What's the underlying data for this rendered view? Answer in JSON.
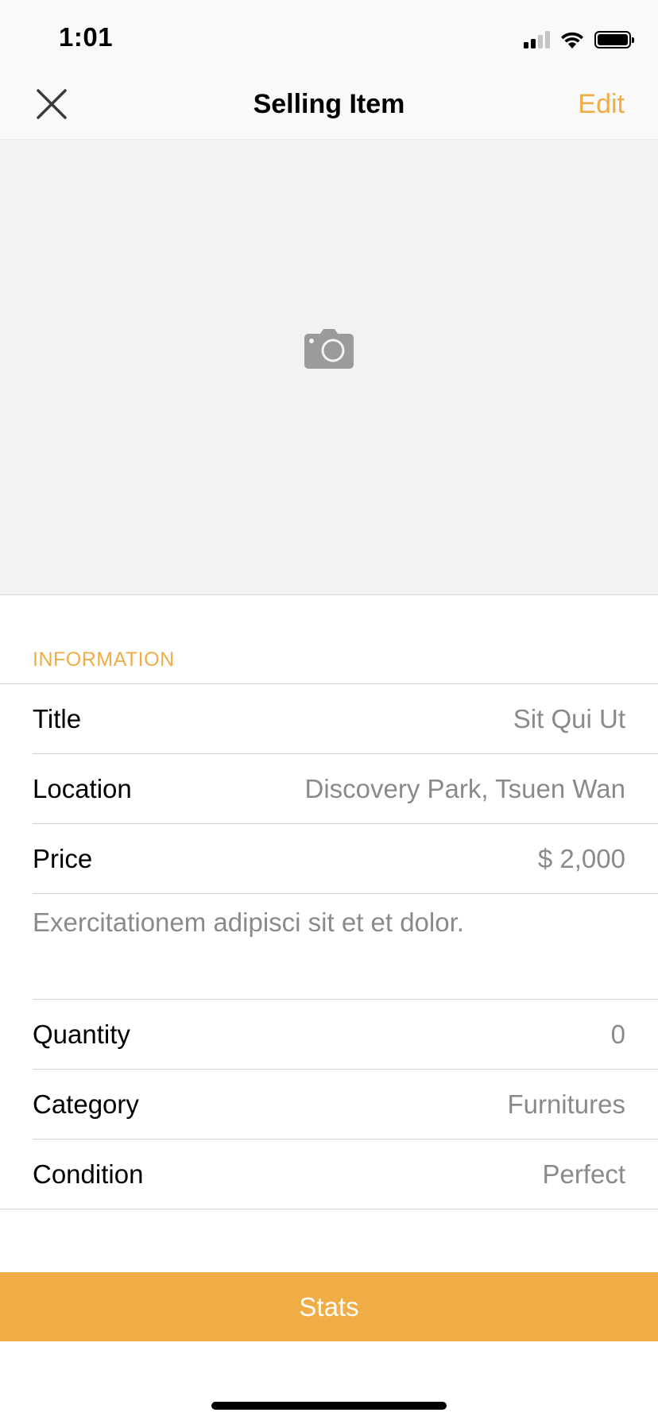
{
  "status_bar": {
    "time": "1:01"
  },
  "nav": {
    "title": "Selling Item",
    "edit_label": "Edit",
    "close_icon": "close-icon"
  },
  "photo": {
    "icon": "camera-icon"
  },
  "information": {
    "header": "INFORMATION",
    "rows": [
      {
        "label": "Title",
        "value": "Sit Qui Ut"
      },
      {
        "label": "Location",
        "value": "Discovery Park, Tsuen Wan"
      },
      {
        "label": "Price",
        "value": "$ 2,000"
      }
    ],
    "description": "Exercitationem adipisci sit et et dolor.",
    "rows2": [
      {
        "label": "Quantity",
        "value": "0"
      },
      {
        "label": "Category",
        "value": "Furnitures"
      },
      {
        "label": "Condition",
        "value": "Perfect"
      }
    ]
  },
  "stats_button": {
    "label": "Stats"
  },
  "colors": {
    "accent": "#f0ad46",
    "secondary_text": "#8a8a8e",
    "photo_bg": "#f2f2f2"
  }
}
